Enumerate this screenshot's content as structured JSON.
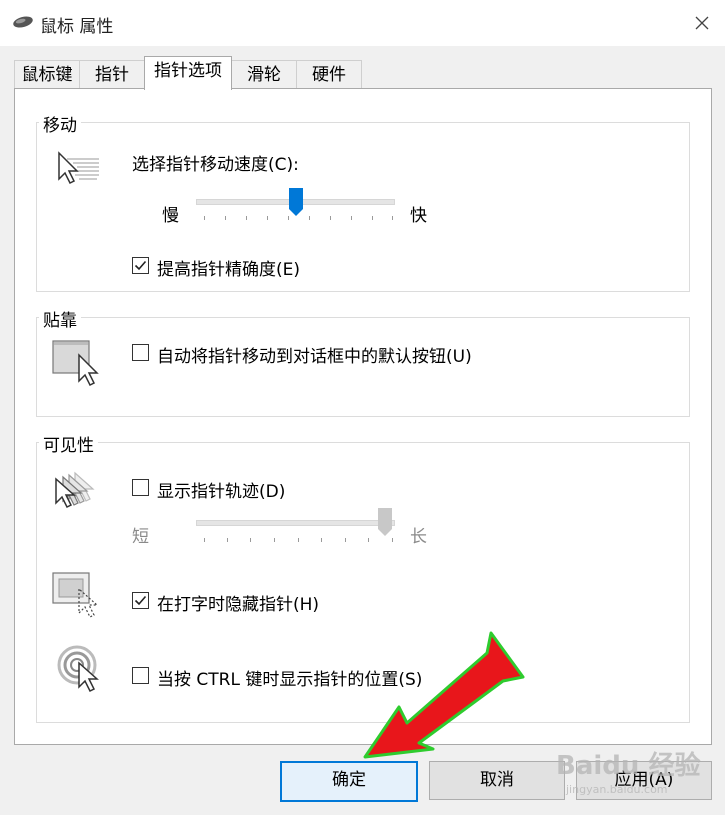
{
  "window": {
    "title": "鼠标 属性"
  },
  "tabs": [
    {
      "label": "鼠标键"
    },
    {
      "label": "指针"
    },
    {
      "label": "指针选项"
    },
    {
      "label": "滑轮"
    },
    {
      "label": "硬件"
    }
  ],
  "motion": {
    "group_title": "移动",
    "speed_label": "选择指针移动速度(C):",
    "slow_label": "慢",
    "fast_label": "快",
    "speed_value": 0.5,
    "precision_label": "提高指针精确度(E)",
    "precision_checked": true
  },
  "snap": {
    "group_title": "贴靠",
    "snap_label": "自动将指针移动到对话框中的默认按钮(U)",
    "snap_checked": false
  },
  "visibility": {
    "group_title": "可见性",
    "trails_label": "显示指针轨迹(D)",
    "trails_checked": false,
    "short_label": "短",
    "long_label": "长",
    "trail_length_value": 1.0,
    "hide_label": "在打字时隐藏指针(H)",
    "hide_checked": true,
    "ctrl_label": "当按 CTRL 键时显示指针的位置(S)",
    "ctrl_checked": false
  },
  "buttons": {
    "ok": "确定",
    "cancel": "取消",
    "apply": "应用(A)"
  },
  "watermark": {
    "logo": "Baidu 经验",
    "url": "jingyan.baidu.com"
  },
  "colors": {
    "accent": "#0078d7",
    "arrow": "#e8161b",
    "arrow_outline": "#2ecc2e"
  }
}
